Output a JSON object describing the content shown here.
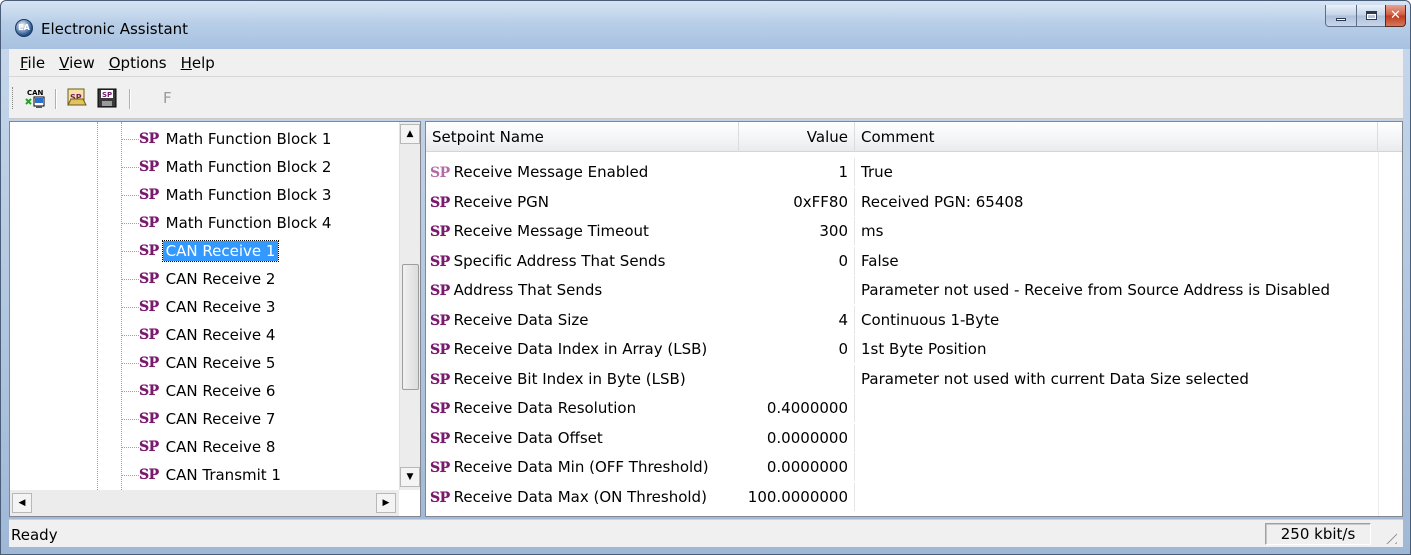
{
  "window": {
    "title": "Electronic Assistant",
    "app_icon_text": "EA"
  },
  "menu": [
    "File",
    "View",
    "Options",
    "Help"
  ],
  "toolbar": {
    "buttons": [
      "can-connect-icon",
      "open-setpoint-file-icon",
      "save-setpoint-file-icon"
    ],
    "disabled_label": "F"
  },
  "tree": {
    "items": [
      {
        "label": "Math Function Block 1",
        "selected": false
      },
      {
        "label": "Math Function Block 2",
        "selected": false
      },
      {
        "label": "Math Function Block 3",
        "selected": false
      },
      {
        "label": "Math Function Block 4",
        "selected": false
      },
      {
        "label": "CAN Receive 1",
        "selected": true
      },
      {
        "label": "CAN Receive 2",
        "selected": false
      },
      {
        "label": "CAN Receive 3",
        "selected": false
      },
      {
        "label": "CAN Receive 4",
        "selected": false
      },
      {
        "label": "CAN Receive 5",
        "selected": false
      },
      {
        "label": "CAN Receive 6",
        "selected": false
      },
      {
        "label": "CAN Receive 7",
        "selected": false
      },
      {
        "label": "CAN Receive 8",
        "selected": false
      },
      {
        "label": "CAN Transmit 1",
        "selected": false
      }
    ],
    "icon_text": "SP"
  },
  "list": {
    "headers": {
      "name": "Setpoint Name",
      "value": "Value",
      "comment": "Comment"
    },
    "rows": [
      {
        "name": "Receive Message Enabled",
        "value": "1",
        "comment": "True",
        "icon_light": true
      },
      {
        "name": "Receive PGN",
        "value": "0xFF80",
        "comment": "Received PGN: 65408",
        "icon_light": false
      },
      {
        "name": "Receive Message Timeout",
        "value": "300",
        "comment": "ms",
        "icon_light": false
      },
      {
        "name": "Specific Address That Sends",
        "value": "0",
        "comment": "False",
        "icon_light": false
      },
      {
        "name": "Address That Sends",
        "value": "",
        "comment": "Parameter not used - Receive from Source Address is Disabled",
        "icon_light": false
      },
      {
        "name": "Receive Data Size",
        "value": "4",
        "comment": "Continuous 1-Byte",
        "icon_light": false
      },
      {
        "name": "Receive Data Index in Array (LSB)",
        "value": "0",
        "comment": "1st Byte Position",
        "icon_light": false
      },
      {
        "name": "Receive Bit Index in Byte (LSB)",
        "value": "",
        "comment": "Parameter not used with current Data Size selected",
        "icon_light": false
      },
      {
        "name": "Receive Data Resolution",
        "value": "0.4000000",
        "comment": "",
        "icon_light": false
      },
      {
        "name": "Receive Data Offset",
        "value": "0.0000000",
        "comment": "",
        "icon_light": false
      },
      {
        "name": "Receive Data Min (OFF Threshold)",
        "value": "0.0000000",
        "comment": "",
        "icon_light": false
      },
      {
        "name": "Receive Data Max (ON Threshold)",
        "value": "100.0000000",
        "comment": "",
        "icon_light": false
      }
    ]
  },
  "status": {
    "text": "Ready",
    "baud": "250 kbit/s"
  },
  "colors": {
    "selection": "#3399ff",
    "sp_icon": "#7a1a6e",
    "sp_icon_light": "#b36aa8"
  }
}
